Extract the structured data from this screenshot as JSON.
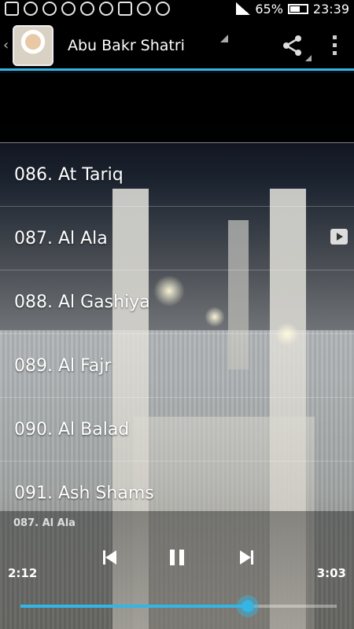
{
  "status_bar": {
    "battery_percent": "65%",
    "battery_level": 0.65,
    "time": "23:39"
  },
  "action_bar": {
    "title": "Abu Bakr Shatri",
    "icons": [
      "up-caret-icon",
      "reciter-avatar",
      "share-icon",
      "overflow-menu-icon"
    ]
  },
  "tracks": [
    {
      "label": "086. At Tariq",
      "playing": false
    },
    {
      "label": "087. Al Ala",
      "playing": true
    },
    {
      "label": "088. Al Gashiya",
      "playing": false
    },
    {
      "label": "089. Al Fajr",
      "playing": false
    },
    {
      "label": "090. Al Balad",
      "playing": false
    },
    {
      "label": "091. Ash Shams",
      "playing": false
    }
  ],
  "player": {
    "now_playing": "087. Al Ala",
    "current_time": "2:12",
    "total_time": "3:03",
    "progress_fraction": 0.72,
    "accent_color": "#33b5e5"
  }
}
